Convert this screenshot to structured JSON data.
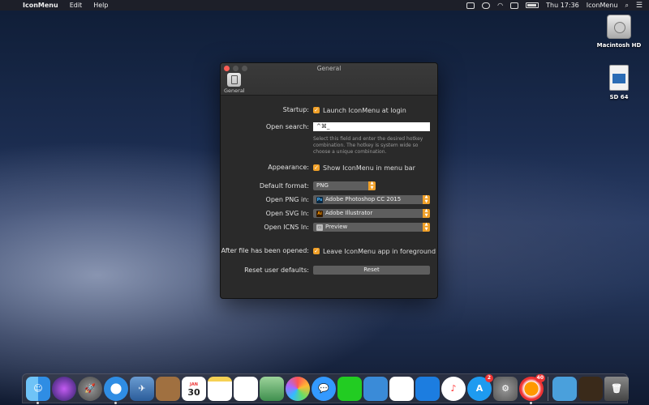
{
  "menubar": {
    "app_name": "IconMenu",
    "menus": [
      "Edit",
      "Help"
    ],
    "clock": "Thu 17:36",
    "right_app": "IconMenu"
  },
  "desktop": {
    "icons": [
      {
        "label": "Macintosh HD"
      },
      {
        "label": "SD 64"
      }
    ]
  },
  "window": {
    "title": "General",
    "toolbar_item": "General",
    "startup_label": "Startup:",
    "startup_option": "Launch IconMenu at login",
    "open_search_label": "Open search:",
    "open_search_value": "^⌘_",
    "open_search_help": "Select this field and enter the desired hotkey combination. The hotkey is system wide so choose a unique combination.",
    "appearance_label": "Appearance:",
    "appearance_option": "Show IconMenu in menu bar",
    "default_format_label": "Default format:",
    "default_format_value": "PNG",
    "open_png_label": "Open PNG in:",
    "open_png_value": "Adobe Photoshop CC 2015",
    "open_svg_label": "Open SVG In:",
    "open_svg_value": "Adobe Illustrator",
    "open_icns_label": "Open ICNS In:",
    "open_icns_value": "Preview",
    "after_open_label": "After file has been opened:",
    "after_open_option": "Leave IconMenu app in foreground",
    "reset_label": "Reset user defaults:",
    "reset_button": "Reset"
  },
  "dock": {
    "calendar_month": "JAN",
    "calendar_day": "30",
    "app_store_badge": "2",
    "app_badge": "40"
  }
}
